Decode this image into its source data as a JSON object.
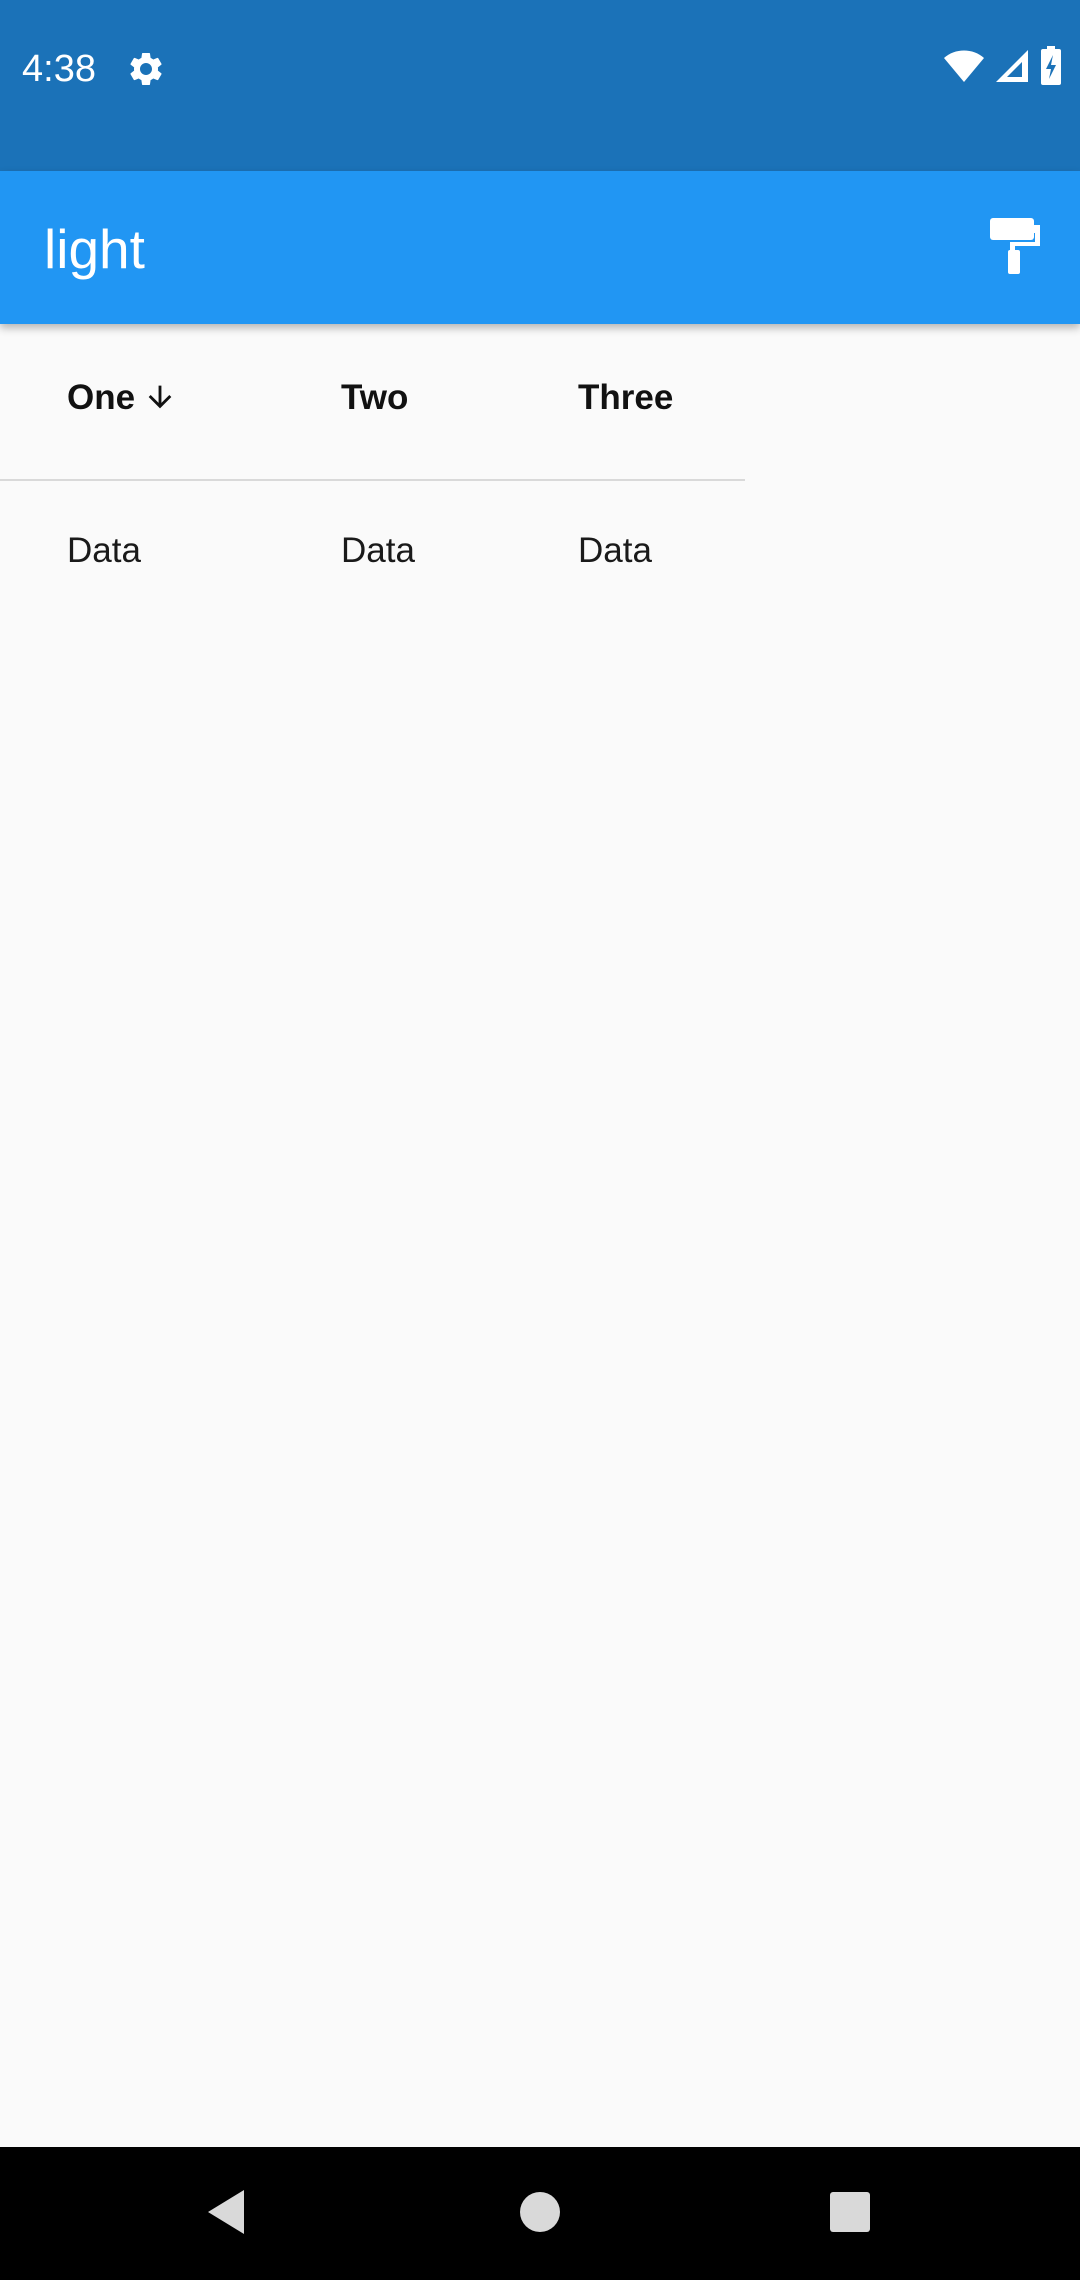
{
  "status_bar": {
    "time": "4:38",
    "background": "#1b72b8",
    "icons": [
      "gear-icon",
      "wifi-icon",
      "cell-signal-icon",
      "battery-charging-icon"
    ]
  },
  "app_bar": {
    "title": "light",
    "background": "#2196f3",
    "action_icon": "paint-roller-icon"
  },
  "table": {
    "columns": [
      {
        "label": "One",
        "sorted": "descending"
      },
      {
        "label": "Two"
      },
      {
        "label": "Three"
      }
    ],
    "rows": [
      [
        "Data",
        "Data",
        "Data"
      ]
    ]
  },
  "nav_bar": {
    "buttons": [
      "back-icon",
      "home-icon",
      "recents-icon"
    ]
  }
}
